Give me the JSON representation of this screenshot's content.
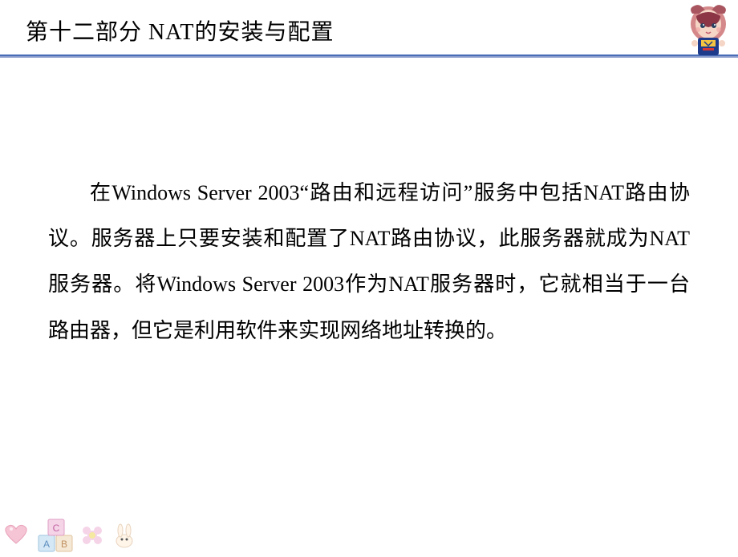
{
  "header": {
    "title": "第十二部分  NAT的安装与配置"
  },
  "content": {
    "paragraph": "在Windows Server 2003“路由和远程访问”服务中包括NAT路由协议。服务器上只要安装和配置了NAT路由协议，此服务器就成为NAT服务器。将Windows Server 2003作为NAT服务器时，它就相当于一台路由器，但它是利用软件来实现网络地址转换的。"
  }
}
